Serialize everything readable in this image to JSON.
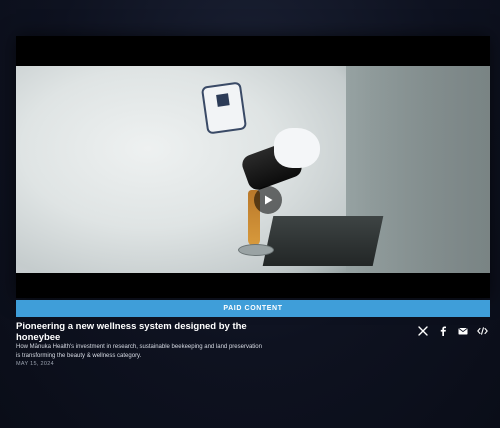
{
  "video": {
    "play_icon": "play-icon"
  },
  "label": {
    "paid_content": "PAID CONTENT"
  },
  "article": {
    "title": "Pioneering a new wellness system designed by the honeybee",
    "description": "How Mānuka Health's investment in research, sustainable beekeeping and land preservation is transforming the beauty & wellness category.",
    "date": "MAY 15, 2024"
  },
  "share": {
    "icons": [
      "x-icon",
      "facebook-icon",
      "email-icon",
      "embed-icon"
    ]
  },
  "colors": {
    "paid_bar": "#3f9ed9",
    "background": "#0e1220"
  }
}
